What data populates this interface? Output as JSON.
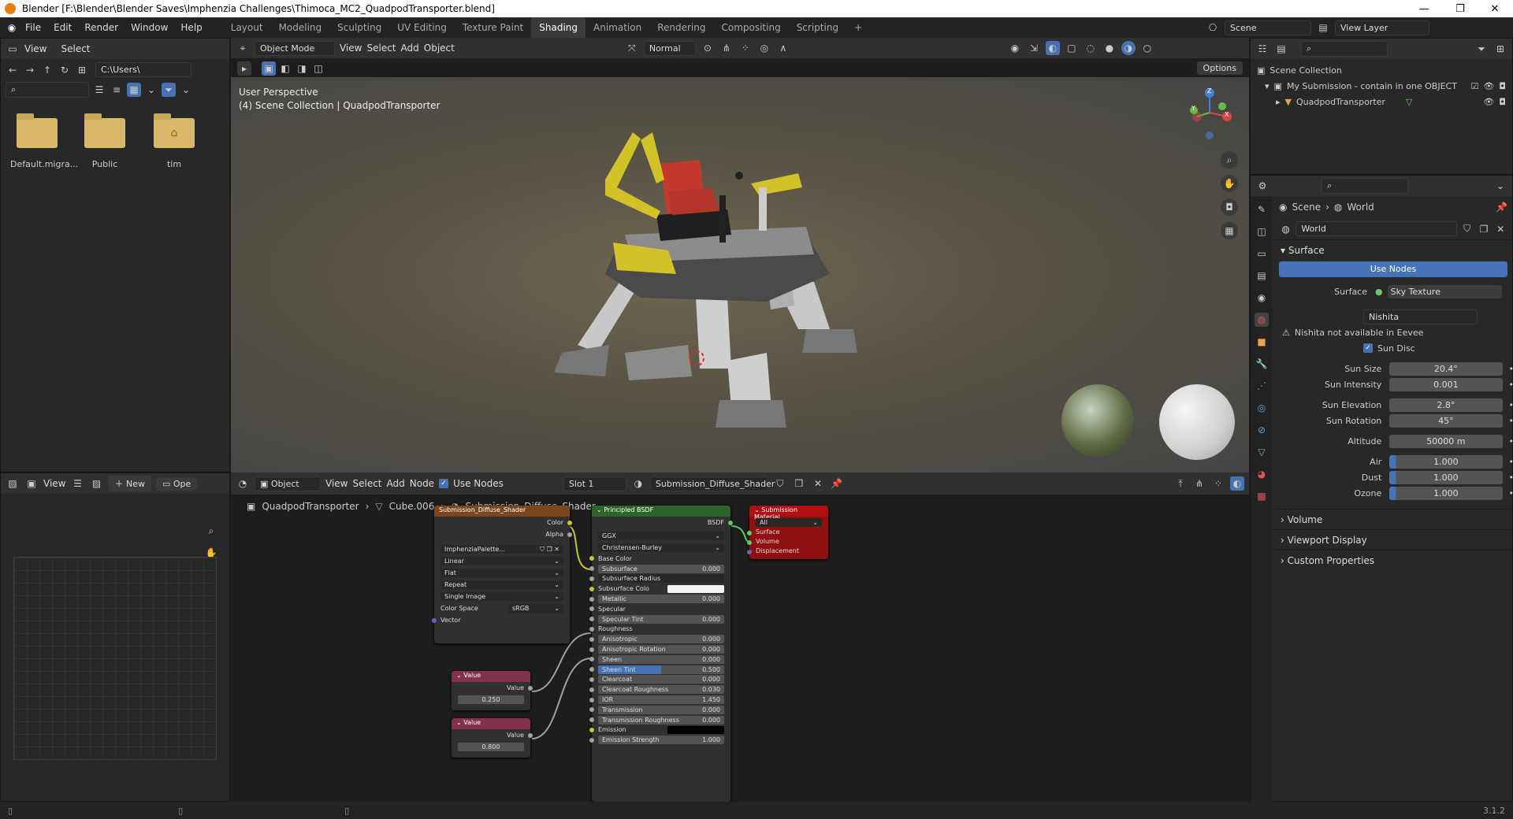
{
  "window": {
    "title": "Blender [F:\\Blender\\Blender Saves\\Imphenzia Challenges\\Thimoca_MC2_QuadpodTransporter.blend]",
    "min": "—",
    "max": "❐",
    "close": "✕"
  },
  "menu": [
    "File",
    "Edit",
    "Render",
    "Window",
    "Help"
  ],
  "workspaces": [
    "Layout",
    "Modeling",
    "Sculpting",
    "UV Editing",
    "Texture Paint",
    "Shading",
    "Animation",
    "Rendering",
    "Compositing",
    "Scripting",
    "+"
  ],
  "active_workspace": "Shading",
  "scene": {
    "name": "Scene",
    "view_layer": "View Layer"
  },
  "file_browser": {
    "menu": [
      "View",
      "Select"
    ],
    "path": "C:\\Users\\",
    "items": [
      {
        "name": "Default.migra...",
        "icon": "folder-icon"
      },
      {
        "name": "Public",
        "icon": "folder-icon"
      },
      {
        "name": "tim",
        "icon": "home-folder-icon"
      }
    ]
  },
  "viewport": {
    "mode": "Object Mode",
    "menu": [
      "View",
      "Select",
      "Add",
      "Object"
    ],
    "orientation": "Normal",
    "options": "Options",
    "overlay_line1": "User Perspective",
    "overlay_line2": "(4) Scene Collection | QuadpodTransporter",
    "gizmo": {
      "x": "X",
      "y": "Y",
      "z": "Z"
    }
  },
  "outliner": {
    "root": "Scene Collection",
    "items": [
      {
        "label": "My Submission - contain in one OBJECT",
        "level": 1
      },
      {
        "label": "QuadpodTransporter",
        "level": 2
      }
    ]
  },
  "properties": {
    "breadcrumb": [
      "Scene",
      "World"
    ],
    "world_name": "World",
    "surface_section": "Surface",
    "use_nodes": "Use Nodes",
    "surface_label": "Surface",
    "surface_value": "Sky Texture",
    "sky_type": "Nishita",
    "warning": "Nishita not available in Eevee",
    "sun_disc": "Sun Disc",
    "fields": [
      {
        "label": "Sun Size",
        "value": "20.4°",
        "slider": false
      },
      {
        "label": "Sun Intensity",
        "value": "0.001",
        "slider": false
      },
      {
        "label": "Sun Elevation",
        "value": "2.8°",
        "slider": false
      },
      {
        "label": "Sun Rotation",
        "value": "45°",
        "slider": false
      },
      {
        "label": "Altitude",
        "value": "50000 m",
        "slider": false
      },
      {
        "label": "Air",
        "value": "1.000",
        "slider": true
      },
      {
        "label": "Dust",
        "value": "1.000",
        "slider": true
      },
      {
        "label": "Ozone",
        "value": "1.000",
        "slider": true
      }
    ],
    "collapsed": [
      "Volume",
      "Viewport Display",
      "Custom Properties"
    ]
  },
  "image_editor": {
    "view": "View",
    "new": "New",
    "open": "Ope"
  },
  "node_editor": {
    "object": "Object",
    "menu": [
      "View",
      "Select",
      "Add",
      "Node"
    ],
    "use_nodes": "Use Nodes",
    "slot": "Slot 1",
    "material": "Submission_Diffuse_Shader",
    "breadcrumb": [
      "QuadpodTransporter",
      "Cube.006",
      "Submission_Diffuse_Shader"
    ]
  },
  "nodes": {
    "image_texture": {
      "title": "Submission_Diffuse_Shader",
      "outputs": [
        "Color",
        "Alpha"
      ],
      "image": "ImphenziaPalette...",
      "options": [
        "Linear",
        "Flat",
        "Repeat",
        "Single Image"
      ],
      "color_space_label": "Color Space",
      "color_space": "sRGB",
      "input": "Vector"
    },
    "value1": {
      "title": "Value",
      "output": "Value",
      "value": "0.250"
    },
    "value2": {
      "title": "Value",
      "output": "Value",
      "value": "0.800"
    },
    "bsdf": {
      "title": "Principled BSDF",
      "output": "BSDF",
      "distribution": "GGX",
      "subsurface_method": "Christensen-Burley",
      "rows": [
        {
          "label": "Base Color",
          "value": "",
          "type": "socket"
        },
        {
          "label": "Subsurface",
          "value": "0.000",
          "type": "field"
        },
        {
          "label": "Subsurface Radius",
          "value": "",
          "type": "drop"
        },
        {
          "label": "Subsurface Colo",
          "value": "",
          "type": "color"
        },
        {
          "label": "Metallic",
          "value": "0.000",
          "type": "field"
        },
        {
          "label": "Specular",
          "value": "",
          "type": "socket"
        },
        {
          "label": "Specular Tint",
          "value": "0.000",
          "type": "field"
        },
        {
          "label": "Roughness",
          "value": "",
          "type": "socket"
        },
        {
          "label": "Anisotropic",
          "value": "0.000",
          "type": "field"
        },
        {
          "label": "Anisotropic Rotation",
          "value": "0.000",
          "type": "field"
        },
        {
          "label": "Sheen",
          "value": "0.000",
          "type": "field"
        },
        {
          "label": "Sheen Tint",
          "value": "0.500",
          "type": "field"
        },
        {
          "label": "Clearcoat",
          "value": "0.000",
          "type": "field"
        },
        {
          "label": "Clearcoat Roughness",
          "value": "0.030",
          "type": "field"
        },
        {
          "label": "IOR",
          "value": "1.450",
          "type": "field"
        },
        {
          "label": "Transmission",
          "value": "0.000",
          "type": "field"
        },
        {
          "label": "Transmission Roughness",
          "value": "0.000",
          "type": "field"
        },
        {
          "label": "Emission",
          "value": "",
          "type": "black"
        },
        {
          "label": "Emission Strength",
          "value": "1.000",
          "type": "field"
        }
      ]
    },
    "output": {
      "title": "Submission Material",
      "target": "All",
      "inputs": [
        "Surface",
        "Volume",
        "Displacement"
      ]
    }
  },
  "status": {
    "version": "3.1.2"
  },
  "colors": {
    "accent": "#4772b3",
    "output_node": "#b10f12",
    "shader_header": "#2b652b",
    "texture_header": "#79461d",
    "value_header": "#83314a"
  }
}
